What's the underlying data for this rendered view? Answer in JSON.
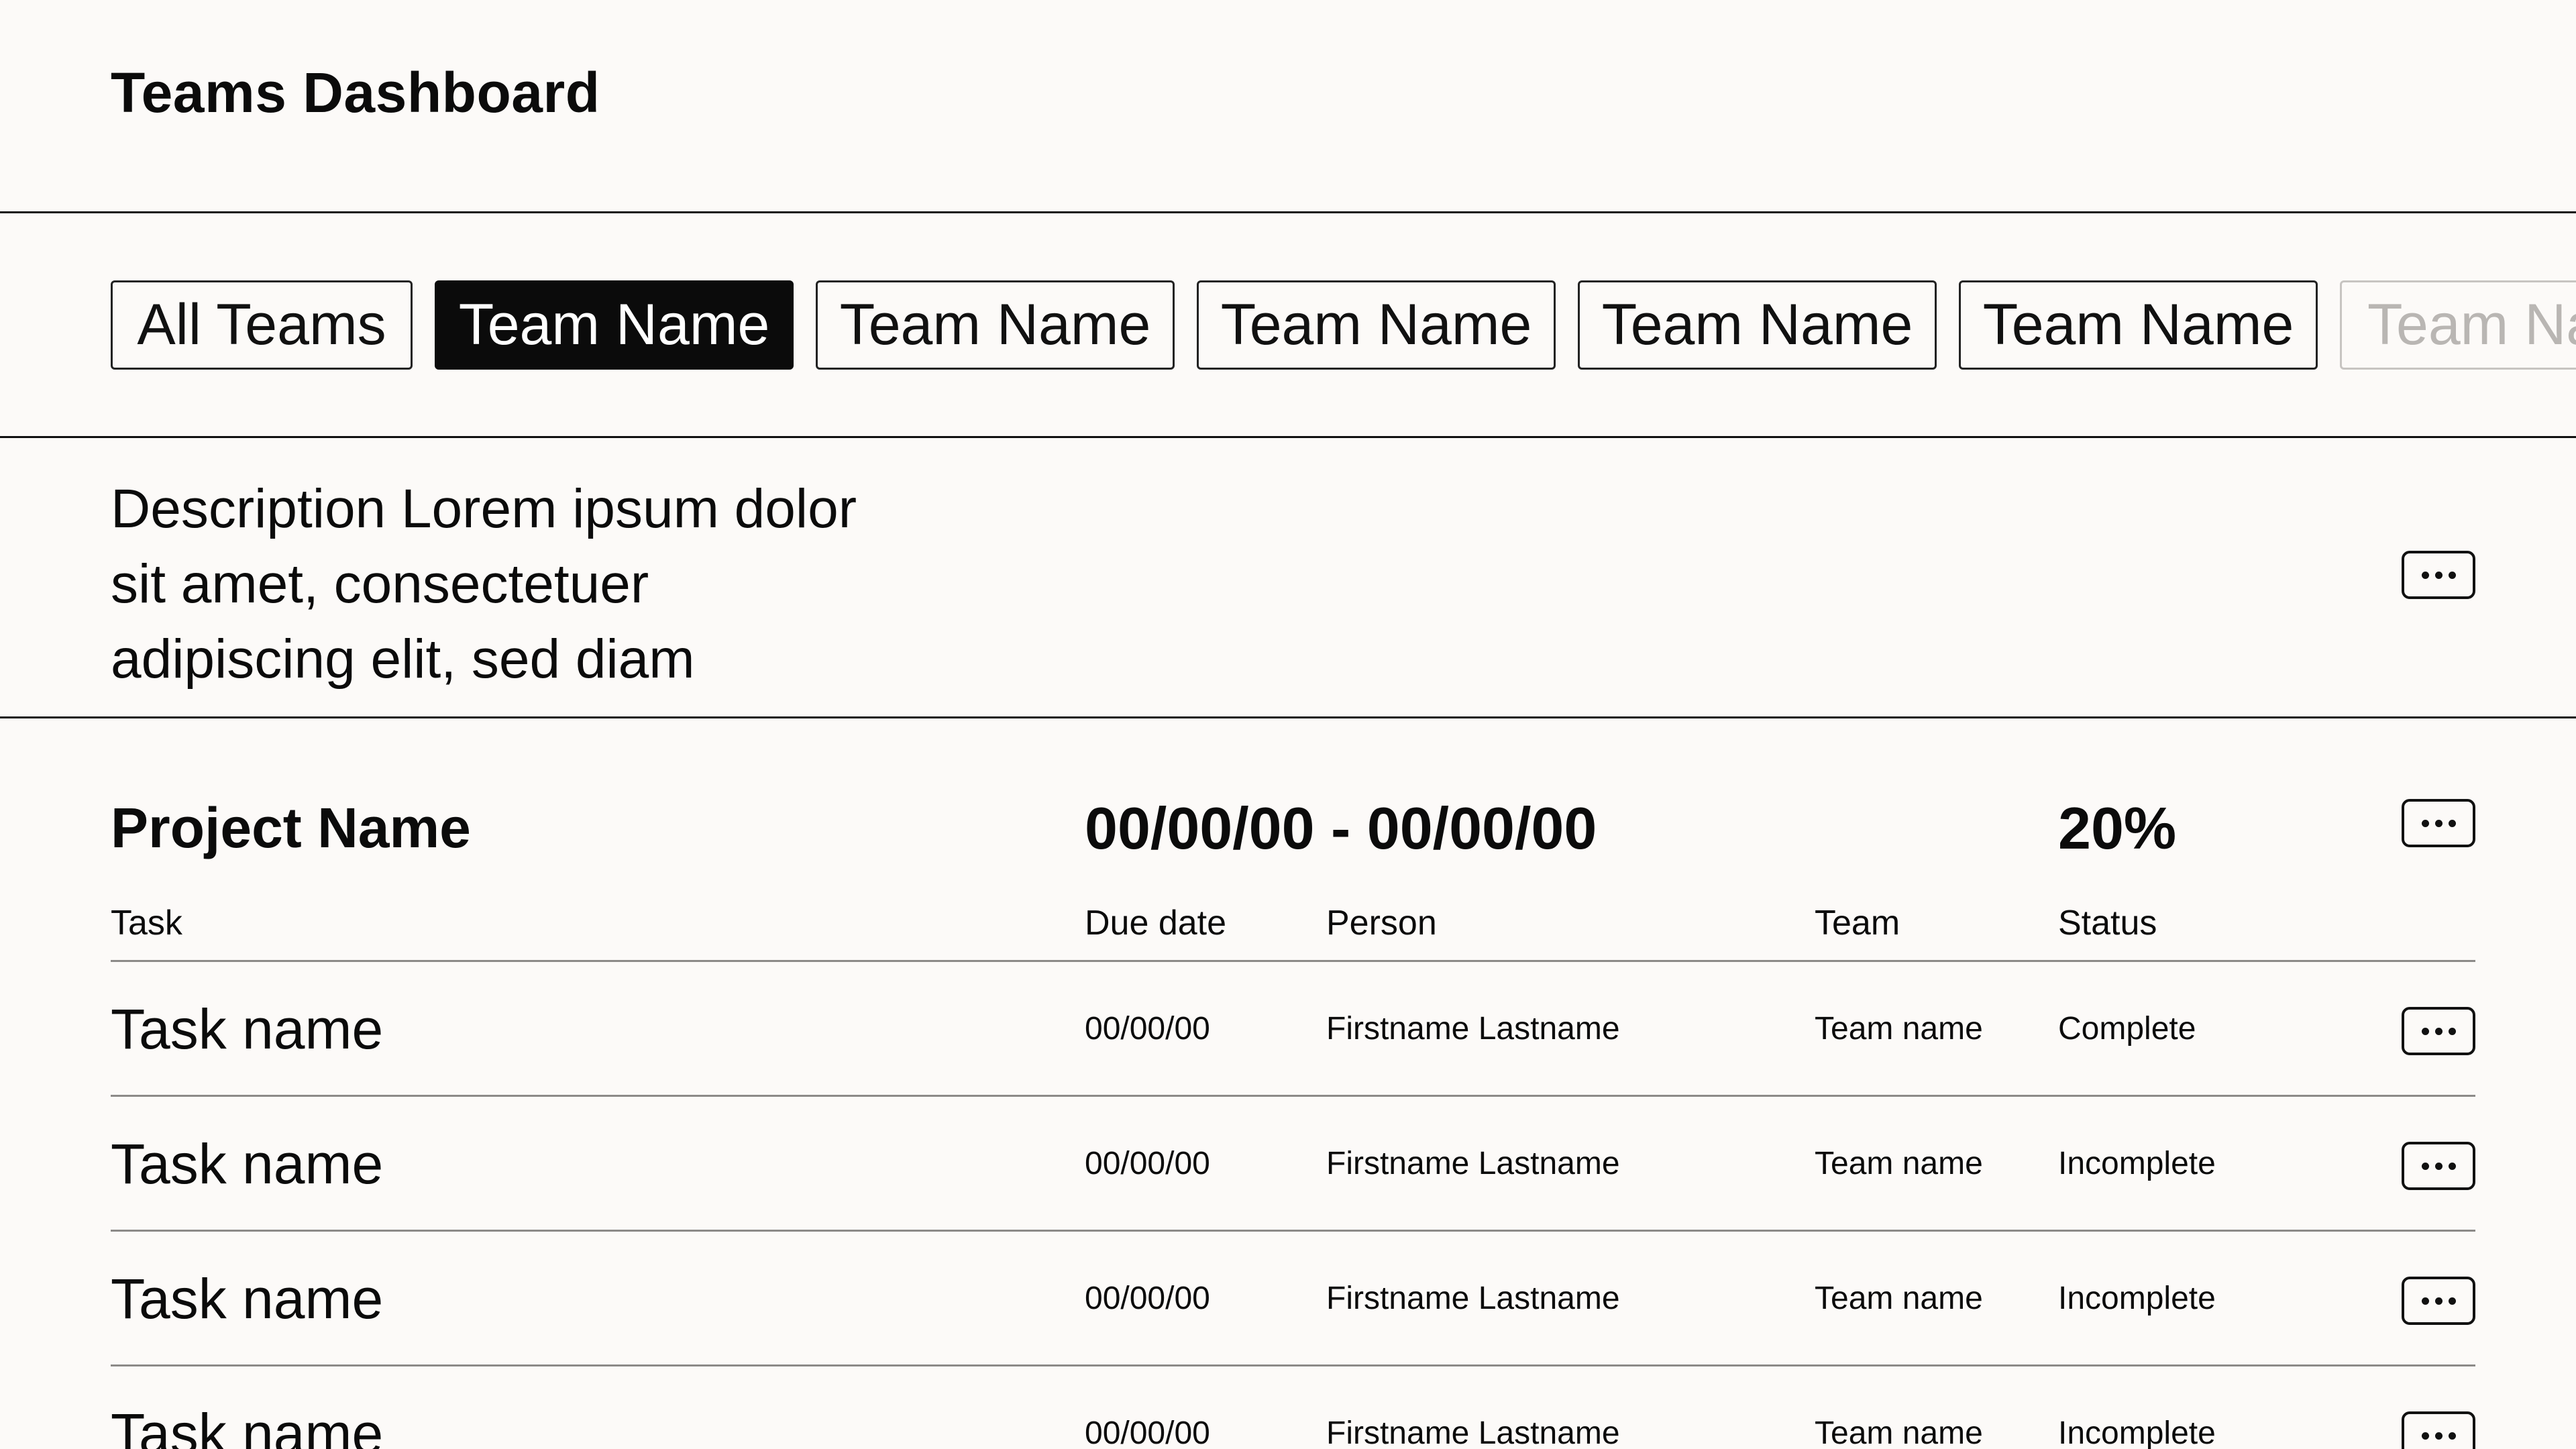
{
  "header": {
    "title": "Teams Dashboard"
  },
  "tabs": [
    {
      "label": "All Teams",
      "active": false
    },
    {
      "label": "Team Name",
      "active": true
    },
    {
      "label": "Team Name",
      "active": false
    },
    {
      "label": "Team Name",
      "active": false
    },
    {
      "label": "Team Name",
      "active": false
    },
    {
      "label": "Team Name",
      "active": false
    },
    {
      "label": "Team Name",
      "active": false,
      "partially_visible": true
    }
  ],
  "description": {
    "text": "Description Lorem ipsum dolor sit amet, consectetuer adipiscing elit, sed diam"
  },
  "project": {
    "name": "Project Name",
    "dates": "00/00/00 - 00/00/00",
    "progress": "20%",
    "columns": {
      "task": "Task",
      "due": "Due date",
      "person": "Person",
      "team": "Team",
      "status": "Status"
    },
    "rows": [
      {
        "task": "Task name",
        "due": "00/00/00",
        "person": "Firstname Lastname",
        "team": "Team name",
        "status": "Complete"
      },
      {
        "task": "Task name",
        "due": "00/00/00",
        "person": "Firstname Lastname",
        "team": "Team name",
        "status": "Incomplete"
      },
      {
        "task": "Task name",
        "due": "00/00/00",
        "person": "Firstname Lastname",
        "team": "Team name",
        "status": "Incomplete"
      },
      {
        "task": "Task name",
        "due": "00/00/00",
        "person": "Firstname Lastname",
        "team": "Team name",
        "status": "Incomplete"
      }
    ]
  },
  "icons": {
    "more": "more-horizontal-icon"
  },
  "colors": {
    "background": "#fcfaf8",
    "text": "#0b0b0b",
    "active_tab_bg": "#0b0b0b",
    "active_tab_text": "#ffffff",
    "faded_tab_text": "#b9b6b3",
    "row_divider": "#8c8a88"
  }
}
